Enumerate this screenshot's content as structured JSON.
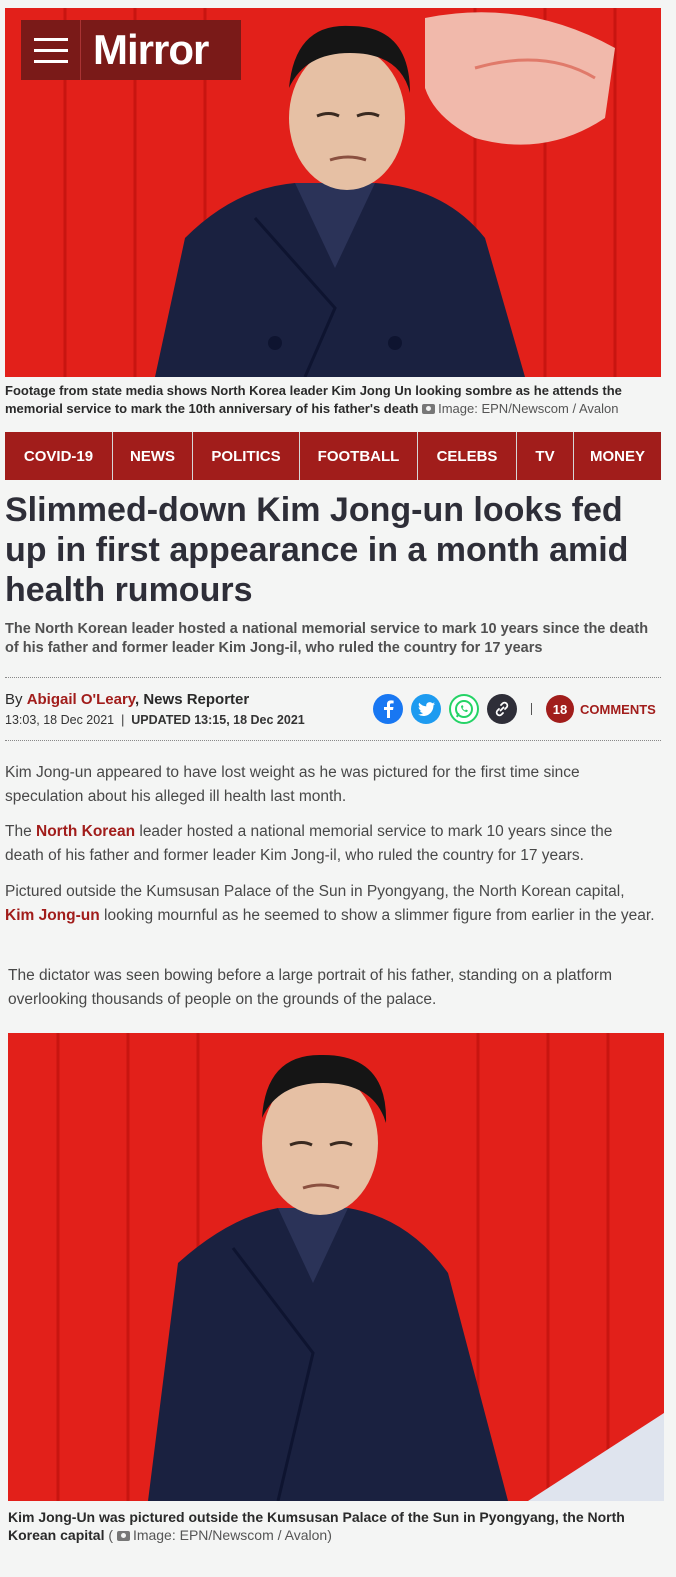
{
  "brand": {
    "logo_text": "Mirror",
    "accent": "#a11d1b"
  },
  "hero": {
    "caption": "Footage from state media shows North Korea leader Kim Jong Un looking sombre as he attends the memorial service to mark the 10th anniversary of his father's death",
    "credit": "Image: EPN/Newscom / Avalon"
  },
  "nav": {
    "items": [
      "COVID-19",
      "NEWS",
      "POLITICS",
      "FOOTBALL",
      "CELEBS",
      "TV",
      "MONEY"
    ]
  },
  "article": {
    "headline": "Slimmed-down Kim Jong-un looks fed up in first appearance in a month amid health rumours",
    "standfirst": "The North Korean leader hosted a national memorial service to mark 10 years since the death of his father and former leader Kim Jong-il, who ruled the country for 17 years",
    "byline_prefix": "By",
    "author": "Abigail O'Leary",
    "role": ", News Reporter",
    "published": "13:03, 18 Dec 2021",
    "updated": "UPDATED 13:15, 18 Dec 2021",
    "comments_count": "18",
    "comments_label": "COMMENTS",
    "p1": "Kim Jong-un appeared to have lost weight as he was pictured for the first time since speculation about his alleged ill health last month.",
    "p2_pre": "The ",
    "p2_link": "North Korean",
    "p2_post": " leader hosted a national memorial service to mark 10 years since the death of his father and former leader Kim Jong-il, who ruled the country for 17 years.",
    "p3_pre": "Pictured outside the Kumsusan Palace of the Sun in Pyongyang, the North Korean capital, ",
    "p3_link": "Kim Jong-un",
    "p3_post": " looking mournful as he seemed to show a slimmer figure from earlier in the year.",
    "p4": "The dictator was seen bowing before a large portrait of his father, standing on a platform overlooking thousands of people on the grounds of the palace."
  },
  "photo2": {
    "caption": "Kim Jong-Un was pictured outside the Kumsusan Palace of the Sun in Pyongyang, the North Korean capital",
    "credit_open": " ( ",
    "credit": "Image: EPN/Newscom / Avalon)"
  },
  "share_icons": [
    "facebook-icon",
    "twitter-icon",
    "whatsapp-icon",
    "link-icon"
  ]
}
